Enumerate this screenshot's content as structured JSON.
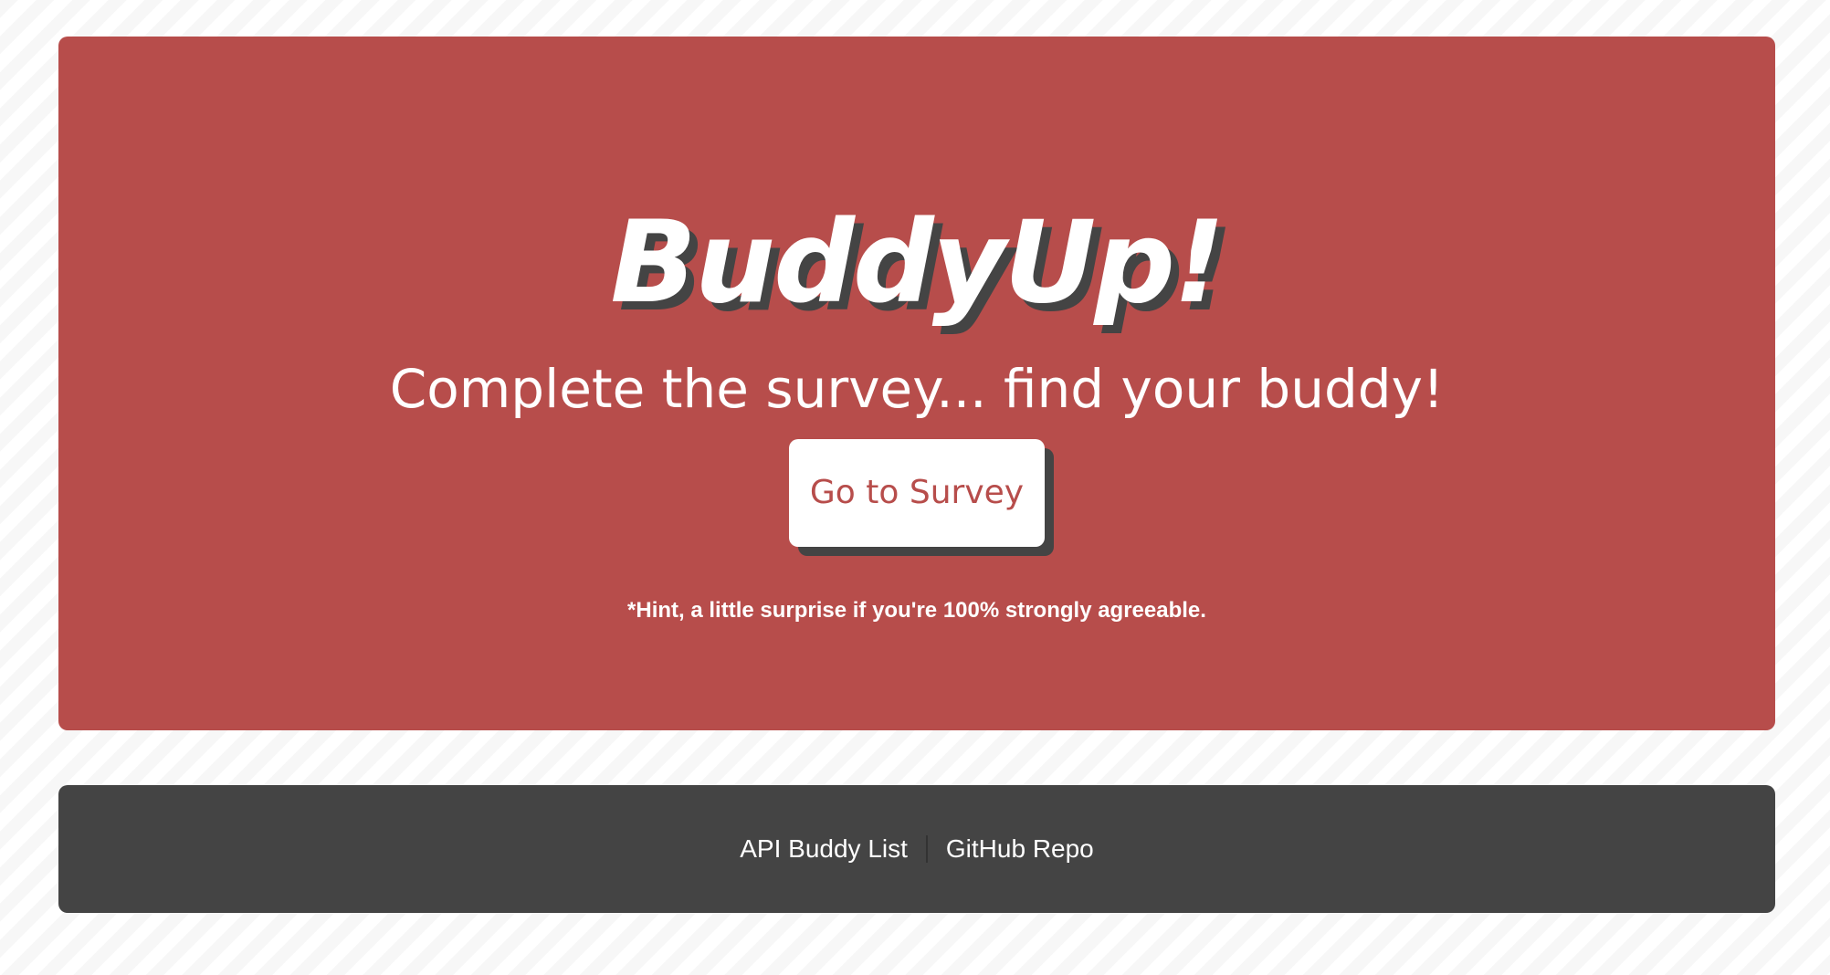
{
  "hero": {
    "title": "BuddyUp!",
    "subtitle": "Complete the survey... find your buddy!",
    "cta_label": "Go to Survey",
    "hint": "*Hint, a little surprise if you're 100% strongly agreeable."
  },
  "footer": {
    "links": [
      {
        "label": "API Buddy List"
      },
      {
        "label": "GitHub Repo"
      }
    ]
  },
  "colors": {
    "accent": "#b74d4b",
    "dark": "#444444",
    "background": "#f7f7f7",
    "text_light": "#ffffff"
  }
}
